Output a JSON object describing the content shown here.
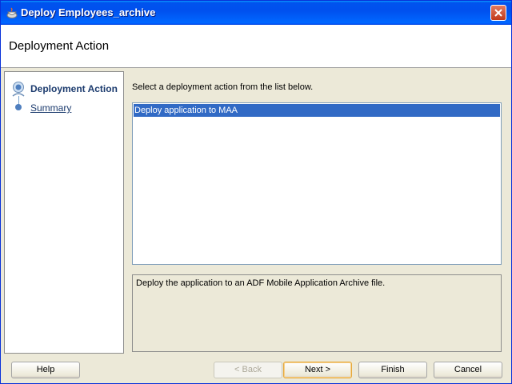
{
  "window": {
    "title": "Deploy Employees_archive"
  },
  "header": {
    "title": "Deployment Action"
  },
  "nav": {
    "items": [
      {
        "label": "Deployment Action",
        "active": true
      },
      {
        "label": "Summary",
        "active": false
      }
    ]
  },
  "content": {
    "instruction": "Select a deployment action from the list below.",
    "actions": [
      "Deploy application to MAA"
    ],
    "selected_action": "Deploy application to MAA",
    "description": "Deploy the application to an ADF Mobile Application Archive file."
  },
  "buttons": {
    "help": "Help",
    "back": "< Back",
    "next": "Next >",
    "finish": "Finish",
    "cancel": "Cancel"
  },
  "colors": {
    "titlebar": "#0053ee",
    "selection": "#316ac5",
    "nav_text": "#1c3b6e"
  }
}
